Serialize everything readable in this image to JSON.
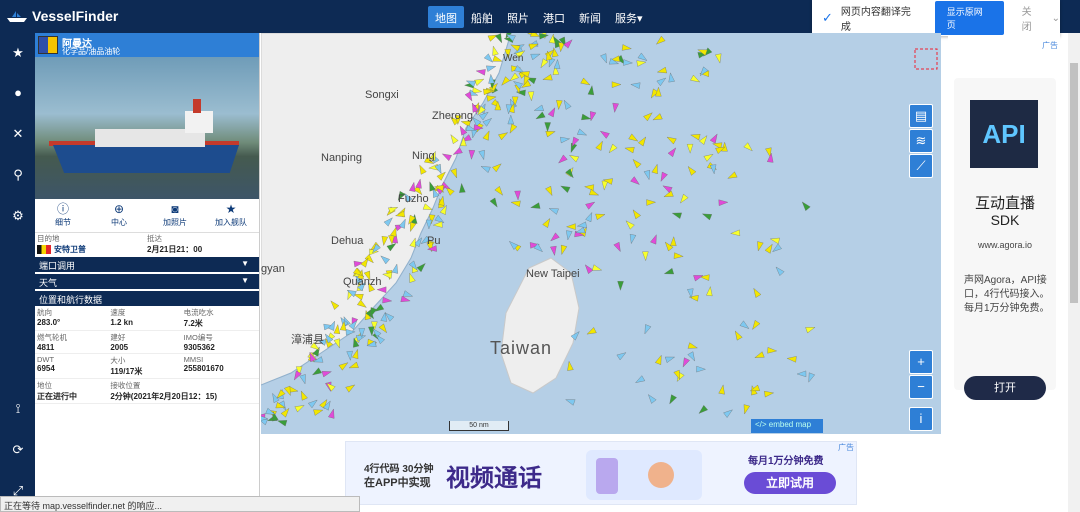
{
  "brand": {
    "name": "VesselFinder"
  },
  "nav": {
    "items": [
      "地图",
      "船舶",
      "照片",
      "港口",
      "新闻",
      "服务▾"
    ],
    "active": 0
  },
  "translate_bar": {
    "message": "网页内容翻译完成",
    "button": "显示原网页",
    "close": "关闭"
  },
  "vessel": {
    "name": "阿曼达",
    "type": "化学品/油品油轮",
    "actions": [
      {
        "label": "细节",
        "icon": "info-icon"
      },
      {
        "label": "中心",
        "icon": "crosshair-icon"
      },
      {
        "label": "加照片",
        "icon": "camera-icon"
      },
      {
        "label": "加入舰队",
        "icon": "star-icon"
      }
    ],
    "destination_label": "目的地",
    "destination": "安特卫普",
    "arrival_label": "抵达",
    "arrival": "2月21日21：00",
    "sections": {
      "port_calls": "端口调用",
      "weather": "天气",
      "position": "位置和航行数据"
    },
    "data": [
      {
        "l1": "航向",
        "v1": "283.0°",
        "l2": "速度",
        "v2": "1.2 kn",
        "l3": "电流吃水",
        "v3": "7.2米"
      },
      {
        "l1": "燃气轮机",
        "v1": "4811",
        "l2": "建好",
        "v2": "2005",
        "l3": "IMO编号",
        "v3": "9305362"
      },
      {
        "l1": "DWT",
        "v1": "6954",
        "l2": "大小",
        "v2": "119/17米",
        "l3": "MMSI",
        "v3": "255801670"
      },
      {
        "l1": "地位",
        "v1": "正在进行中",
        "l2": "接收位置",
        "v2": "2分钟(2021年2月20日12：15)",
        "l3": "",
        "v3": ""
      }
    ]
  },
  "map": {
    "labels": [
      {
        "name": "Wenzhou",
        "text": "Wen"
      },
      {
        "name": "Songxi",
        "text": "Songxi"
      },
      {
        "name": "Zherong",
        "text": "Zherong"
      },
      {
        "name": "Nanping",
        "text": "Nanping"
      },
      {
        "name": "Ningde",
        "text": "Ning"
      },
      {
        "name": "Fuzhou",
        "text": "Fuzho"
      },
      {
        "name": "Dehua",
        "text": "Dehua"
      },
      {
        "name": "Putian",
        "text": "Pu"
      },
      {
        "name": "Quanzhou",
        "text": "Quanzh"
      },
      {
        "name": "Longyan",
        "text": "gyan"
      },
      {
        "name": "New Taipei",
        "text": "New Taipei"
      },
      {
        "name": "Zhangpu",
        "text": "漳浦县"
      },
      {
        "name": "Taiwan",
        "text": "Taiwan"
      }
    ],
    "scale": "50 nm",
    "embed": "</> embed map",
    "zoom_in": "+",
    "zoom_out": "−",
    "info": "i"
  },
  "bottom_ad": {
    "line1": "4行代码 30分钟",
    "line2": "在APP中实现",
    "headline": "视频通话",
    "right_line": "每月1万分钟免费",
    "cta": "立即试用",
    "badge": "广告"
  },
  "right_ad": {
    "badge": "广告",
    "logo": "API",
    "title1": "互动直播",
    "title2": "SDK",
    "url": "www.agora.io",
    "body": "声网Agora，API接口，4行代码接入。每月1万分钟免费。",
    "cta": "打开"
  },
  "status_bar": {
    "text": "正在等待 map.vesselfinder.net 的响应..."
  },
  "colors": {
    "navy": "#0d2a54",
    "blue": "#2e7fd6",
    "land": "#eeeeee",
    "sea": "#b5cfe6"
  }
}
